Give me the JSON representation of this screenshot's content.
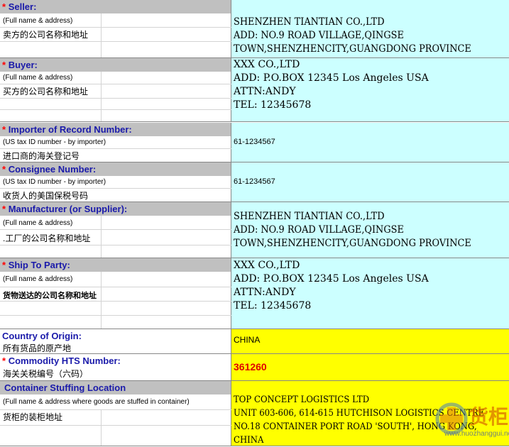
{
  "sections": [
    {
      "id": "seller",
      "required": true,
      "title": "Seller:",
      "hint": "(Full name & address)",
      "cn": "卖方的公司名称和地址",
      "values": [
        "SHENZHEN TIANTIAN CO.,LTD",
        "ADD: NO.9 ROAD VILLAGE,QINGSE",
        "TOWN,SHENZHENCITY,GUANGDONG PROVINCE"
      ]
    },
    {
      "id": "buyer",
      "required": true,
      "title": "Buyer:",
      "hint": "(Full name & address)",
      "cn": "买方的公司名称和地址",
      "values": [
        "XXX CO.,LTD",
        "ADD: P.O.BOX 12345 Los Angeles USA",
        "ATTN:ANDY",
        "TEL: 12345678"
      ]
    },
    {
      "id": "importer",
      "required": true,
      "title": "Importer of Record Number:",
      "hint": "(US tax ID number - by importer)",
      "cn": "进口商的海关登记号",
      "values": [
        "61-1234567"
      ]
    },
    {
      "id": "consignee",
      "required": true,
      "title": "Consignee Number:",
      "hint": "(US tax ID number - by importer)",
      "cn": "收货人的美国保税号码",
      "values": [
        "61-1234567"
      ]
    },
    {
      "id": "manufacturer",
      "required": true,
      "title": "Manufacturer (or Supplier):",
      "hint": "(Full name & address)",
      "cn": ".工厂的公司名称和地址",
      "values": [
        "SHENZHEN TIANTIAN CO.,LTD",
        "ADD: NO.9 ROAD VILLAGE,QINGSE",
        "TOWN,SHENZHENCITY,GUANGDONG PROVINCE"
      ]
    },
    {
      "id": "ship_to",
      "required": true,
      "title": "Ship To Party:",
      "hint": "(Full name & address)",
      "cn": "货物送达的公司名称和地址",
      "values": [
        "XXX CO.,LTD",
        "ADD: P.O.BOX 12345 Los Angeles USA",
        "ATTN:ANDY",
        "TEL: 12345678"
      ]
    },
    {
      "id": "origin",
      "required": false,
      "title": "Country of Origin:",
      "cn": "所有货品的原产地",
      "values": [
        "CHINA"
      ]
    },
    {
      "id": "hts",
      "required": true,
      "title": "Commodity HTS Number:",
      "cn": "海关关税编号（六码）",
      "values": [
        "361260"
      ]
    },
    {
      "id": "stuffing",
      "required": false,
      "title": "Container Stuffing Location",
      "hint": "(Full name & address where goods are stuffed in container)",
      "cn": "货柜的装柜地址",
      "values": [
        "TOP CONCEPT LOGISTICS LTD",
        "UNIT 603-606, 614-615 HUTCHISON LOGISTICS CENTRE",
        "NO.18 CONTAINER PORT ROAD 'SOUTH', HONG KONG,",
        "CHINA"
      ]
    }
  ],
  "required_mark": "*",
  "watermark": {
    "text": "货柜",
    "url": "www.huozhanggui.net",
    "color": "#d86a00"
  },
  "colors": {
    "header_gray": "#c0c0c0",
    "label_blue": "#1a1aaa",
    "value_cyan": "#ccffff",
    "value_yellow": "#ffff00",
    "required_red": "#ff0000",
    "hts_red": "#e00000"
  }
}
